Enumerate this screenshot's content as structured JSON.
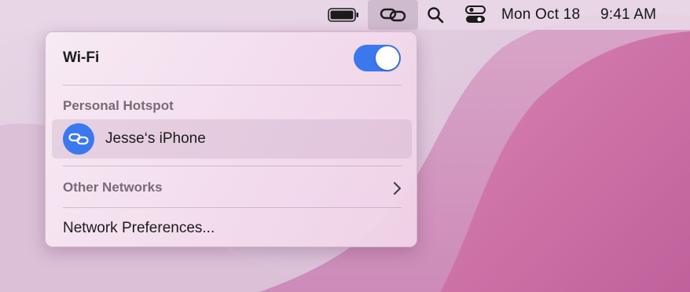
{
  "menubar": {
    "battery_icon": "battery-full-icon",
    "hotspot_icon": "personal-hotspot-link-icon",
    "search_icon": "spotlight-search-icon",
    "control_center_icon": "control-center-icon",
    "date": "Mon Oct 18",
    "time": "9:41 AM"
  },
  "wifi_menu": {
    "wifi_label": "Wi-Fi",
    "wifi_enabled": true,
    "personal_hotspot_header": "Personal Hotspot",
    "device_name": "Jesse‘s iPhone",
    "device_icon": "personal-hotspot-link-icon",
    "other_networks_label": "Other Networks",
    "other_networks_icon": "chevron-right-icon",
    "preferences_label": "Network Preferences..."
  },
  "colors": {
    "accent": "#3b78f0",
    "wallpaper_pink": "#c96a9f",
    "menu_bg": "#f3dfee"
  }
}
